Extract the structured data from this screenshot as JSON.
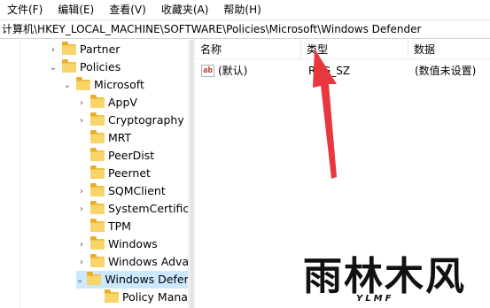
{
  "menu": {
    "file": "文件(F)",
    "edit": "编辑(E)",
    "view": "查看(V)",
    "favorites": "收藏夹(A)",
    "help": "帮助(H)"
  },
  "address": "计算机\\HKEY_LOCAL_MACHINE\\SOFTWARE\\Policies\\Microsoft\\Windows Defender",
  "tree": {
    "items": [
      {
        "label": "Partner",
        "expanded": false
      },
      {
        "label": "Policies",
        "expanded": true
      },
      {
        "label": "Microsoft",
        "expanded": true
      },
      {
        "label": "AppV",
        "expanded": false
      },
      {
        "label": "Cryptography",
        "expanded": false
      },
      {
        "label": "MRT",
        "expanded": null
      },
      {
        "label": "PeerDist",
        "expanded": null
      },
      {
        "label": "Peernet",
        "expanded": null
      },
      {
        "label": "SQMClient",
        "expanded": false
      },
      {
        "label": "SystemCertificates",
        "expanded": false
      },
      {
        "label": "TPM",
        "expanded": null
      },
      {
        "label": "Windows",
        "expanded": false
      },
      {
        "label": "Windows Advanced Threat Protection",
        "expanded": false
      },
      {
        "label": "Windows Defender",
        "expanded": true,
        "selected": true
      },
      {
        "label": "Policy Manager",
        "expanded": null
      }
    ]
  },
  "list": {
    "columns": [
      "名称",
      "类型",
      "数据"
    ],
    "rows": [
      {
        "icon": "string-value-icon",
        "icon_text": "ab",
        "name": "(默认)",
        "type": "REG_SZ",
        "data": "(数值未设置)"
      }
    ]
  },
  "annotation": {
    "arrow_color": "#e8383d"
  },
  "watermark": {
    "main": "雨林木风",
    "sub": "YLMF"
  }
}
